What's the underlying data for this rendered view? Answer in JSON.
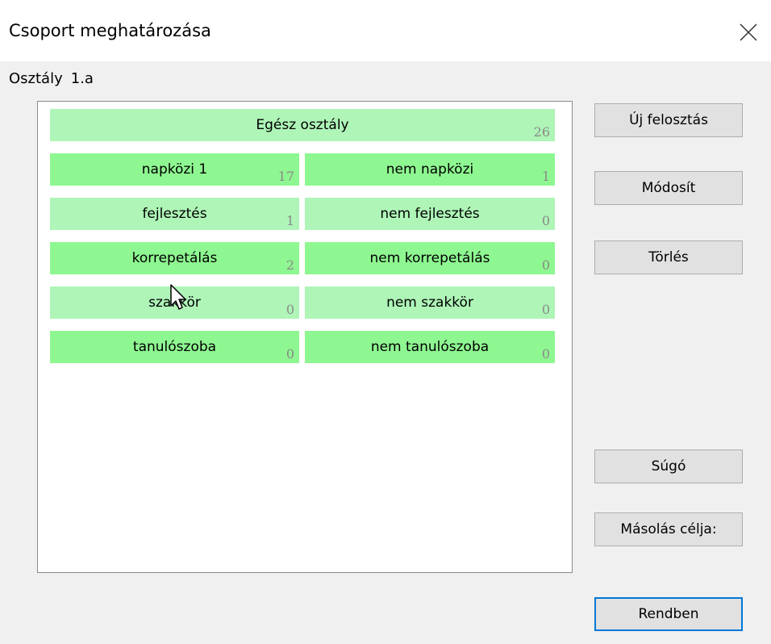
{
  "window": {
    "title": "Csoport meghatározása",
    "close_icon": "close-icon"
  },
  "class_field": {
    "label": "Osztály",
    "value": "1.a"
  },
  "groups": {
    "whole": {
      "label": "Egész osztály",
      "count": "26"
    },
    "rows": [
      {
        "left": {
          "label": "napközi 1",
          "count": "17"
        },
        "right": {
          "label": "nem napközi",
          "count": "1"
        }
      },
      {
        "left": {
          "label": "fejlesztés",
          "count": "1"
        },
        "right": {
          "label": "nem fejlesztés",
          "count": "0"
        }
      },
      {
        "left": {
          "label": "korrepetálás",
          "count": "2"
        },
        "right": {
          "label": "nem korrepetálás",
          "count": "0"
        }
      },
      {
        "left": {
          "label": "szakkör",
          "count": "0"
        },
        "right": {
          "label": "nem szakkör",
          "count": "0"
        }
      },
      {
        "left": {
          "label": "tanulószoba",
          "count": "0"
        },
        "right": {
          "label": "nem tanulószoba",
          "count": "0"
        }
      }
    ]
  },
  "buttons": {
    "new_split": "Új felosztás",
    "modify": "Módosít",
    "delete": "Törlés",
    "help": "Súgó",
    "copy_target": "Másolás célja:",
    "ok": "Rendben"
  },
  "colors": {
    "light_green": "#aef5b7",
    "dark_green": "#8ef791",
    "accent": "#0078d7"
  }
}
